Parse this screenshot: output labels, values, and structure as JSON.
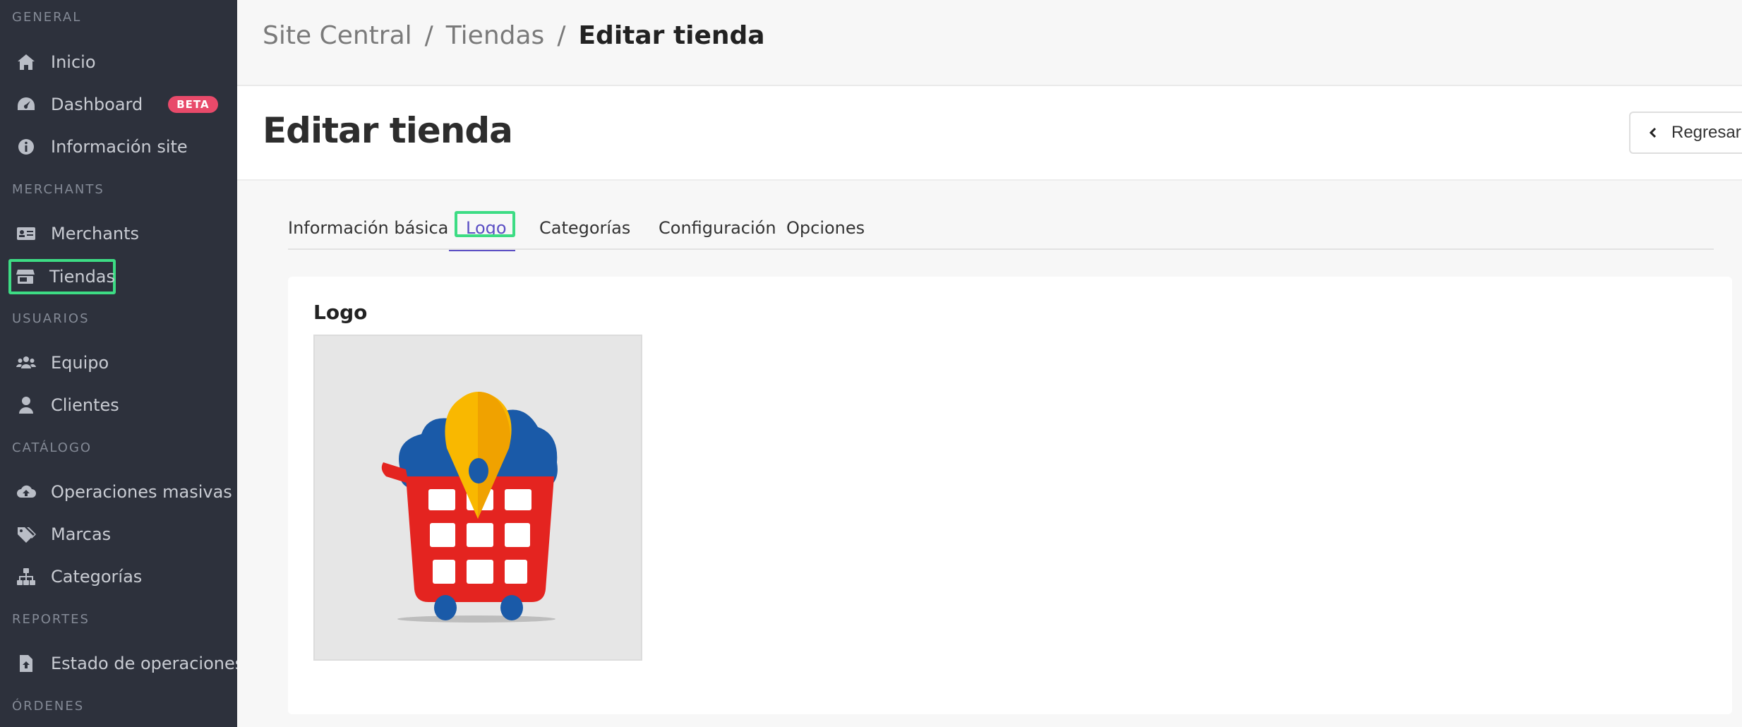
{
  "sidebar": {
    "sections": [
      {
        "title": "GENERAL"
      },
      {
        "title": "MERCHANTS"
      },
      {
        "title": "USUARIOS"
      },
      {
        "title": "CATÁLOGO"
      },
      {
        "title": "REPORTES"
      },
      {
        "title": "ÓRDENES"
      }
    ],
    "items": [
      {
        "label": "Inicio",
        "icon": "home-icon"
      },
      {
        "label": "Dashboard",
        "icon": "gauge-icon",
        "badge": "BETA"
      },
      {
        "label": "Información site",
        "icon": "info-icon"
      },
      {
        "label": "Merchants",
        "icon": "id-card-icon"
      },
      {
        "label": "Tiendas",
        "icon": "store-icon"
      },
      {
        "label": "Equipo",
        "icon": "users-icon"
      },
      {
        "label": "Clientes",
        "icon": "user-icon"
      },
      {
        "label": "Operaciones masivas",
        "icon": "cloud-upload-icon"
      },
      {
        "label": "Marcas",
        "icon": "tags-icon"
      },
      {
        "label": "Categorías",
        "icon": "sitemap-icon"
      },
      {
        "label": "Estado de operaciones",
        "icon": "file-upload-icon"
      }
    ]
  },
  "breadcrumb": {
    "items": [
      "Site Central",
      "Tiendas"
    ],
    "current": "Editar tienda",
    "separator": "/"
  },
  "page": {
    "title": "Editar tienda",
    "back_label": "Regresar"
  },
  "tabs": [
    {
      "label": "Información básica"
    },
    {
      "label": "Logo",
      "active": true
    },
    {
      "label": "Categorías"
    },
    {
      "label": "Configuración"
    },
    {
      "label": "Opciones"
    }
  ],
  "card": {
    "title": "Logo"
  },
  "colors": {
    "sidebar_bg": "#2d313c",
    "accent": "#5b4fc4",
    "highlight": "#3ddc84",
    "badge": "#e84a6a"
  }
}
